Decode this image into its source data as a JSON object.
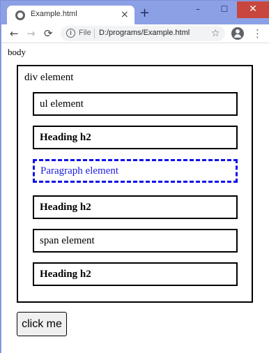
{
  "browser": {
    "tab_title": "Example.html",
    "tab_close": "×",
    "new_tab": "+",
    "window_buttons": {
      "minimize": "–",
      "maximize": "☐",
      "close": "✕"
    },
    "nav": {
      "back": "←",
      "forward": "→",
      "reload": "⟳"
    },
    "omnibox": {
      "info": "i",
      "scheme_label": "File",
      "url": "D:/programs/Example.html"
    },
    "star": "☆",
    "menu": "⋮"
  },
  "page": {
    "body_label": "body",
    "div_label": "div element",
    "children": [
      {
        "text": "ul element",
        "style": "normal"
      },
      {
        "text": "Heading h2",
        "style": "bold"
      },
      {
        "text": "Paragraph element",
        "style": "dashed"
      },
      {
        "text": "Heading h2",
        "style": "bold"
      },
      {
        "text": "span element",
        "style": "normal"
      },
      {
        "text": "Heading h2",
        "style": "bold"
      }
    ],
    "button_label": "click me"
  },
  "colors": {
    "title_bar": "#8ca0e6",
    "close_button": "#c8463d",
    "dashed_border": "#1010e8"
  }
}
